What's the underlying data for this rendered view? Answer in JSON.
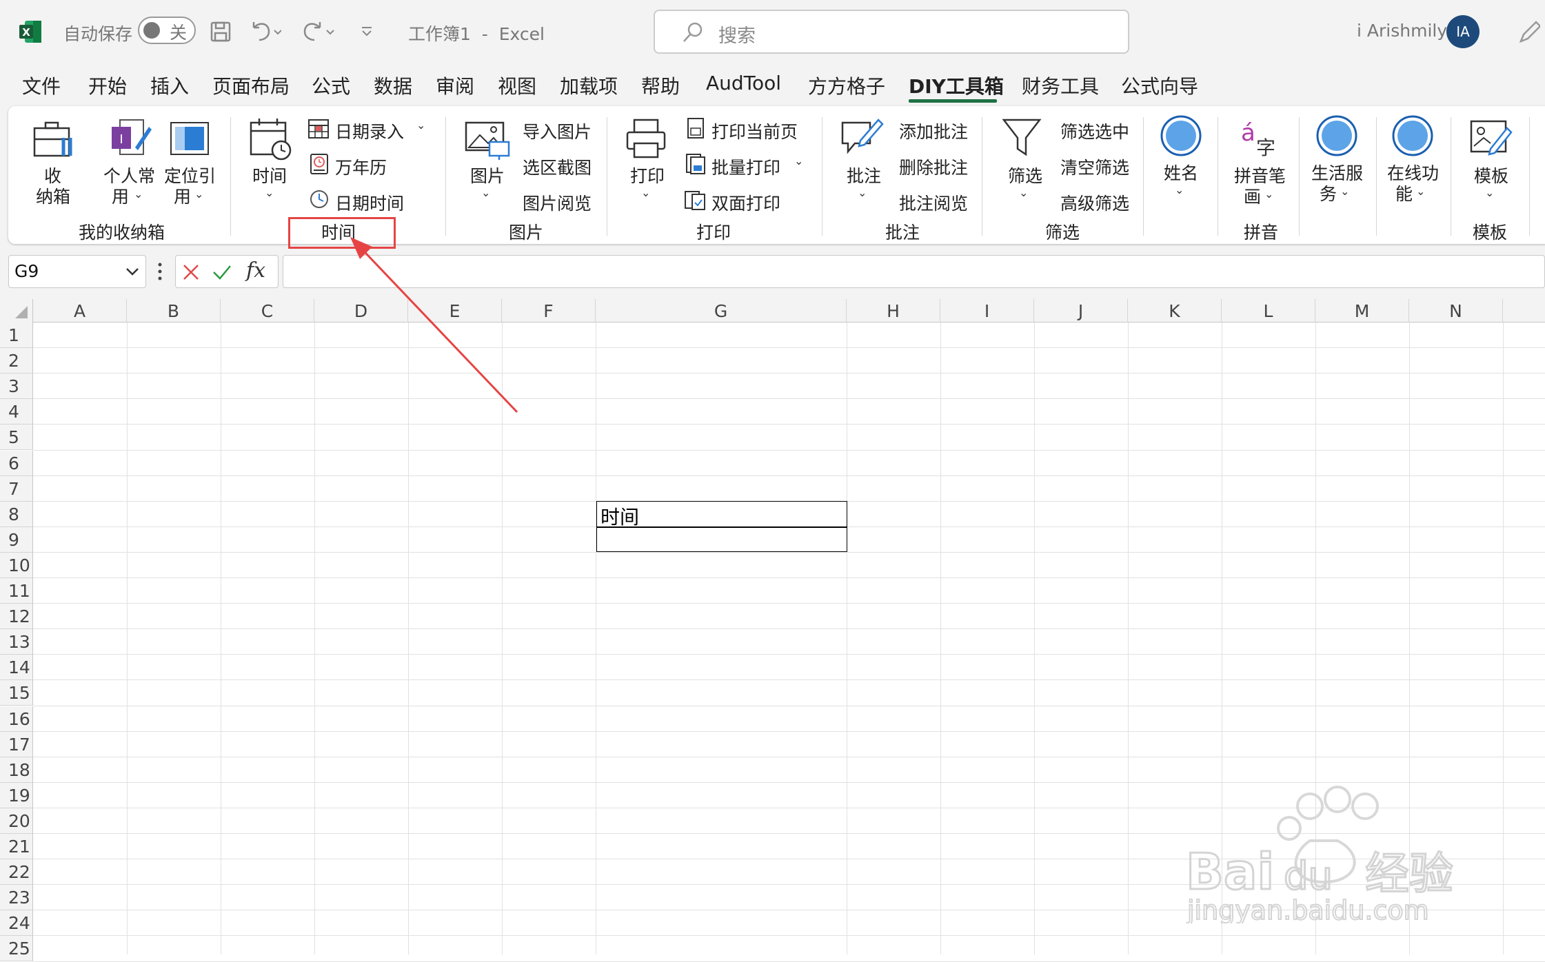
{
  "titlebar": {
    "autosave_label": "自动保存",
    "autosave_state": "关",
    "doc_title": "工作簿1  -  Excel",
    "search_placeholder": "搜索",
    "user_name": "i Arishmily",
    "avatar_initials": "IA"
  },
  "tabs": [
    {
      "label": "文件"
    },
    {
      "label": "开始"
    },
    {
      "label": "插入"
    },
    {
      "label": "页面布局"
    },
    {
      "label": "公式"
    },
    {
      "label": "数据"
    },
    {
      "label": "审阅"
    },
    {
      "label": "视图"
    },
    {
      "label": "加载项"
    },
    {
      "label": "帮助"
    },
    {
      "label": "AudTool"
    },
    {
      "label": "方方格子"
    },
    {
      "label": "DIY工具箱"
    },
    {
      "label": "财务工具"
    },
    {
      "label": "公式向导"
    }
  ],
  "ribbon": {
    "storage": {
      "btn1_line1": "收",
      "btn1_line2": "纳箱",
      "btn2_line1": "个人常",
      "btn2_line2": "用",
      "btn3_line1": "定位引",
      "btn3_line2": "用",
      "group": "我的收纳箱"
    },
    "time": {
      "big": "时间",
      "item1": "日期录入",
      "item2": "万年历",
      "item3": "日期时间",
      "group": "时间"
    },
    "picture": {
      "big": "图片",
      "item1": "导入图片",
      "item2": "选区截图",
      "item3": "图片阅览",
      "group": "图片"
    },
    "print": {
      "big": "打印",
      "item1": "打印当前页",
      "item2": "批量打印",
      "item3": "双面打印",
      "group": "打印"
    },
    "comment": {
      "big": "批注",
      "item1": "添加批注",
      "item2": "删除批注",
      "item3": "批注阅览",
      "group": "批注"
    },
    "filter": {
      "big": "筛选",
      "item1": "筛选选中",
      "item2": "清空筛选",
      "item3": "高级筛选",
      "group": "筛选"
    },
    "name": {
      "big": "姓名"
    },
    "pinyin": {
      "big_line1": "拼音笔",
      "big_line2": "画",
      "group": "拼音"
    },
    "life": {
      "line1": "生活服",
      "line2": "务"
    },
    "online": {
      "line1": "在线功",
      "line2": "能"
    },
    "template": {
      "big": "模板",
      "group": "模板"
    }
  },
  "formula_bar": {
    "name_box": "G9",
    "fx_label": "fx",
    "formula": ""
  },
  "grid": {
    "columns": [
      "A",
      "B",
      "C",
      "D",
      "E",
      "F",
      "G",
      "H",
      "I",
      "J",
      "K",
      "L",
      "M",
      "N"
    ],
    "rows": [
      "1",
      "2",
      "3",
      "4",
      "5",
      "6",
      "7",
      "8",
      "9",
      "10",
      "11",
      "12",
      "13",
      "14",
      "15",
      "16",
      "17",
      "18",
      "19",
      "20",
      "21",
      "22",
      "23",
      "24",
      "25"
    ],
    "cell_G8": "时间",
    "cell_G9": ""
  },
  "watermark": {
    "brand": "Baidu经验",
    "url": "jingyan.baidu.com"
  },
  "colors": {
    "excel_green": "#1e7145",
    "highlight_red": "#e64444",
    "avatar_blue": "#1d4a7b"
  }
}
